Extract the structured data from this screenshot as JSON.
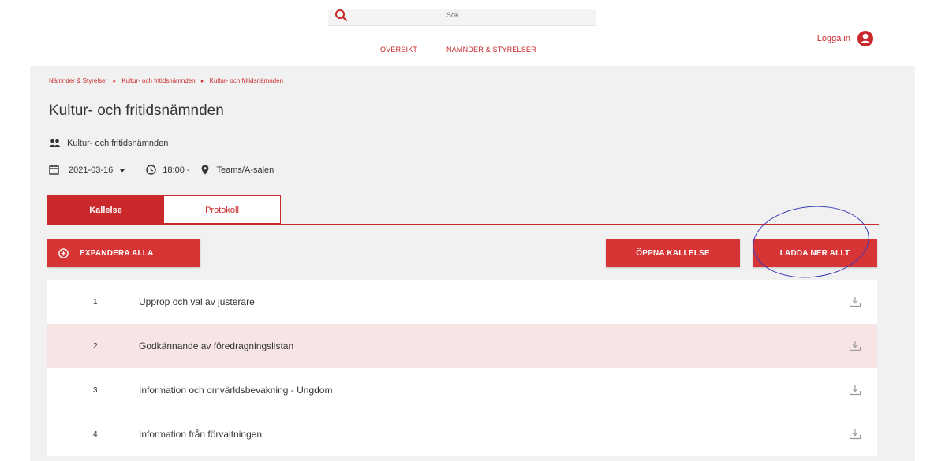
{
  "header": {
    "search_placeholder": "Sök",
    "nav": {
      "oversikt": "ÖVERSIKT",
      "namnder": "NÄMNDER & STYRELSER"
    },
    "login": "Logga in"
  },
  "breadcrumb": {
    "items": [
      "Nämnder & Styrelser",
      "Kultur- och fritidsnämnden",
      "Kultur- och fritidsnämnden"
    ],
    "separator": "▸"
  },
  "page": {
    "title": "Kultur- och fritidsnämnden",
    "committee": "Kultur- och fritidsnämnden",
    "date": "2021-03-16",
    "time": "18:00 -",
    "location": "Teams/A-salen"
  },
  "tabs": {
    "active": "Kallelse",
    "inactive": "Protokoll"
  },
  "buttons": {
    "expand_all": "EXPANDERA ALLA",
    "open_notice": "ÖPPNA KALLELSE",
    "download_all": "LADDA NER ALLT"
  },
  "agenda": [
    {
      "number": "1",
      "label": "Upprop och val av justerare"
    },
    {
      "number": "2",
      "label": "Godkännande av föredragningslistan"
    },
    {
      "number": "3",
      "label": "Information och omvärldsbevakning - Ungdom"
    },
    {
      "number": "4",
      "label": "Information från förvaltningen"
    }
  ],
  "colors": {
    "accent": "#c9292b",
    "button": "#d63435",
    "highlight_row": "#f7e5e5",
    "annotation": "#3a3ab8"
  },
  "icons": [
    "search-icon",
    "user-icon",
    "people-icon",
    "calendar-icon",
    "caret-down-icon",
    "clock-icon",
    "location-pin-icon",
    "plus-circle-icon",
    "download-icon"
  ]
}
